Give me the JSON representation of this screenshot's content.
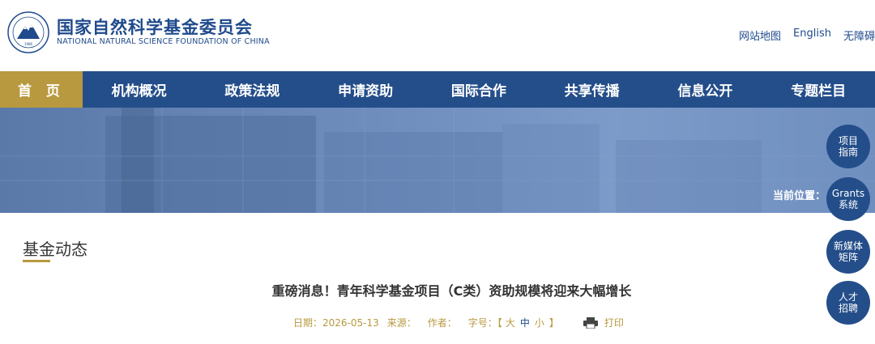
{
  "header": {
    "org_name_cn": "国家自然科学基金委员会",
    "org_name_en": "NATIONAL NATURAL SCIENCE FOUNDATION OF CHINA",
    "logo_year": "1986",
    "links": [
      "网站地图",
      "English",
      "无障碍"
    ]
  },
  "nav": {
    "items": [
      "首 页",
      "机构概况",
      "政策法规",
      "申请资助",
      "国际合作",
      "共享传播",
      "信息公开",
      "专题栏目"
    ],
    "active_index": 0
  },
  "banner": {
    "location_label": "当前位置："
  },
  "floating": {
    "buttons": [
      "项目\n指南",
      "Grants\n系统",
      "新媒体\n矩阵",
      "人才\n招聘"
    ]
  },
  "content": {
    "section_title": "基金动态",
    "article_title": "重磅消息！青年科学基金项目（C类）资助规模将迎来大幅增长",
    "meta": {
      "date_label": "日期：",
      "date": "2026-05-13",
      "source_label": "来源：",
      "author_label": "作者：",
      "fontsize_label": "字号：【",
      "size_large": "大",
      "size_medium": "中",
      "size_small": "小",
      "fontsize_close": "】",
      "print_label": "打印"
    }
  },
  "colors": {
    "primary_blue": "#244e8a",
    "gold": "#b8993f"
  }
}
